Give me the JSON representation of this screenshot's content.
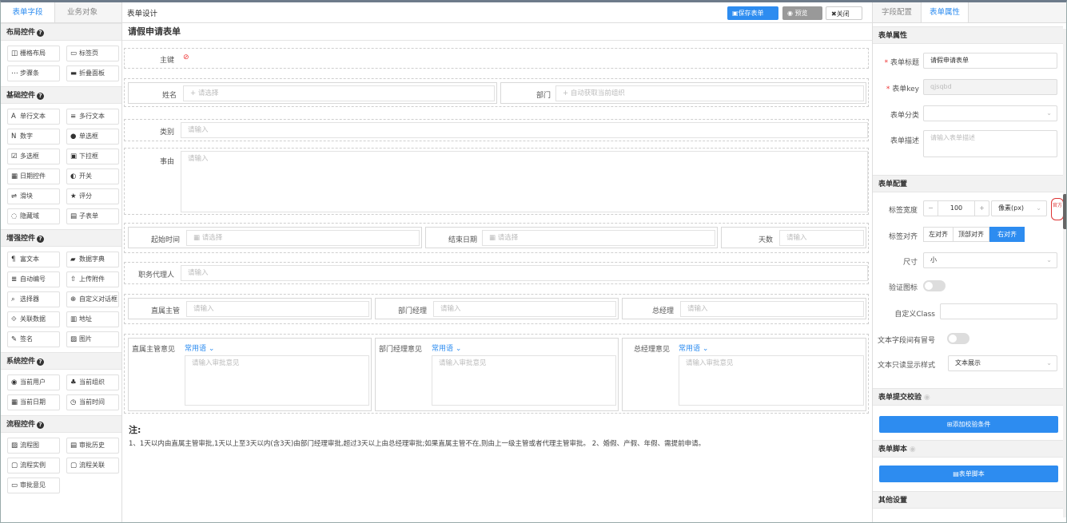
{
  "left": {
    "tabs": [
      "表单字段",
      "业务对象"
    ],
    "sections": [
      {
        "title": "布局控件",
        "items": [
          {
            "icon": "grid-icon",
            "glyph": "◫",
            "label": "栅格布局"
          },
          {
            "icon": "tab-icon",
            "glyph": "▭",
            "label": "标签页"
          },
          {
            "icon": "steps-icon",
            "glyph": "⋯",
            "label": "步骤条"
          },
          {
            "icon": "collapse-panel-icon",
            "glyph": "▬",
            "label": "折叠面板"
          }
        ]
      },
      {
        "title": "基础控件",
        "items": [
          {
            "icon": "text-icon",
            "glyph": "A",
            "label": "单行文本"
          },
          {
            "icon": "textarea-icon",
            "glyph": "≡",
            "label": "多行文本"
          },
          {
            "icon": "number-icon",
            "glyph": "N",
            "label": "数字"
          },
          {
            "icon": "radio-icon",
            "glyph": "●",
            "label": "单选框"
          },
          {
            "icon": "checkbox-icon",
            "glyph": "☑",
            "label": "多选框"
          },
          {
            "icon": "select-icon",
            "glyph": "▣",
            "label": "下拉框"
          },
          {
            "icon": "date-icon",
            "glyph": "▦",
            "label": "日期控件"
          },
          {
            "icon": "switch-icon",
            "glyph": "◐",
            "label": "开关"
          },
          {
            "icon": "slider-icon",
            "glyph": "⇌",
            "label": "滑块"
          },
          {
            "icon": "star-icon",
            "glyph": "★",
            "label": "评分"
          },
          {
            "icon": "hidden-icon",
            "glyph": "◌",
            "label": "隐藏域"
          },
          {
            "icon": "subtable-icon",
            "glyph": "▤",
            "label": "子表单"
          }
        ]
      },
      {
        "title": "增强控件",
        "items": [
          {
            "icon": "richtext-icon",
            "glyph": "¶",
            "label": "富文本"
          },
          {
            "icon": "dictionary-icon",
            "glyph": "▰",
            "label": "数据字典"
          },
          {
            "icon": "autonumber-icon",
            "glyph": "≣",
            "label": "自动编号"
          },
          {
            "icon": "upload-icon",
            "glyph": "⇧",
            "label": "上传附件"
          },
          {
            "icon": "selector-icon",
            "glyph": "⌕",
            "label": "选择器"
          },
          {
            "icon": "custom-dialog-icon",
            "glyph": "⊕",
            "label": "自定义对话框"
          },
          {
            "icon": "link-data-icon",
            "glyph": "⟐",
            "label": "关联数据"
          },
          {
            "icon": "address-icon",
            "glyph": "▥",
            "label": "地址"
          },
          {
            "icon": "signature-icon",
            "glyph": "✎",
            "label": "签名"
          },
          {
            "icon": "image-icon",
            "glyph": "▨",
            "label": "图片"
          }
        ]
      },
      {
        "title": "系统控件",
        "items": [
          {
            "icon": "current-user-icon",
            "glyph": "◉",
            "label": "当前用户"
          },
          {
            "icon": "current-org-icon",
            "glyph": "♣",
            "label": "当前组织"
          },
          {
            "icon": "current-date-icon",
            "glyph": "▦",
            "label": "当前日期"
          },
          {
            "icon": "current-time-icon",
            "glyph": "◷",
            "label": "当前时间"
          }
        ]
      },
      {
        "title": "流程控件",
        "items": [
          {
            "icon": "flowchart-icon",
            "glyph": "▨",
            "label": "流程图"
          },
          {
            "icon": "history-icon",
            "glyph": "▤",
            "label": "审批历史"
          },
          {
            "icon": "instance-icon",
            "glyph": "▢",
            "label": "流程实例"
          },
          {
            "icon": "flow-link-icon",
            "glyph": "▢",
            "label": "流程关联"
          },
          {
            "icon": "opinion-icon",
            "glyph": "▭",
            "label": "审批意见"
          }
        ]
      }
    ]
  },
  "center": {
    "header_title": "表单设计",
    "save_label": "保存表单",
    "preview_label": "预览",
    "close_label": "关闭",
    "form_title": "请假申请表单",
    "fields": {
      "primary_key": "主键",
      "name": "姓名",
      "name_ph": "+ 请选择",
      "dept": "部门",
      "dept_ph": "+ 自动获取当前组织",
      "category": "类别",
      "category_ph": "请输入",
      "reason": "事由",
      "reason_ph": "请输入",
      "start": "起始时间",
      "start_ph": "请选择",
      "end": "结束日期",
      "end_ph": "请选择",
      "days": "天数",
      "days_ph": "请输入",
      "deputy": "职务代理人",
      "deputy_ph": "请输入",
      "supervisor": "直属主管",
      "supervisor_ph": "请输入",
      "dept_manager": "部门经理",
      "dept_manager_ph": "请输入",
      "gm": "总经理",
      "gm_ph": "请输入",
      "sup_opinion": "直属主管意见",
      "mgr_opinion": "部门经理意见",
      "gm_opinion": "总经理意见",
      "common_phrase": "常用语",
      "opinion_ph": "请输入审批意见"
    },
    "note_title": "注:",
    "note_text": "1、1天以内由直属主管审批,1天以上至3天以内(含3天)由部门经理审批,超过3天以上由总经理审批;如果直属主管不在,则由上一级主管或者代理主管审批。 2、婚假、产假、年假、需提前申请。"
  },
  "right": {
    "tabs": [
      "字段配置",
      "表单属性"
    ],
    "sec_props": "表单属性",
    "title_label": "表单标题",
    "title_value": "请假申请表单",
    "key_label": "表单key",
    "key_value": "qjsqbd",
    "category_label": "表单分类",
    "desc_label": "表单描述",
    "desc_ph": "请输入表单描述",
    "sec_config": "表单配置",
    "label_width_label": "标签宽度",
    "label_width_value": "100",
    "unit": "像素(px)",
    "label_align_label": "标签对齐",
    "align_left": "左对齐",
    "align_top": "顶部对齐",
    "align_right": "右对齐",
    "size_label": "尺寸",
    "size_value": "小",
    "verify_icon_label": "验证图标",
    "custom_class_label": "自定义Class",
    "colon_label": "文本字段间有冒号",
    "readonly_label": "文本只读显示样式",
    "readonly_value": "文本展示",
    "sec_validate": "表单提交校验",
    "add_validate": "添加校验条件",
    "sec_script": "表单脚本",
    "script_btn": "表单脚本",
    "sec_other": "其他设置",
    "stamp_text": "官方"
  },
  "colors": {
    "accent": "#2d8cf0",
    "stamp": "#d33"
  }
}
